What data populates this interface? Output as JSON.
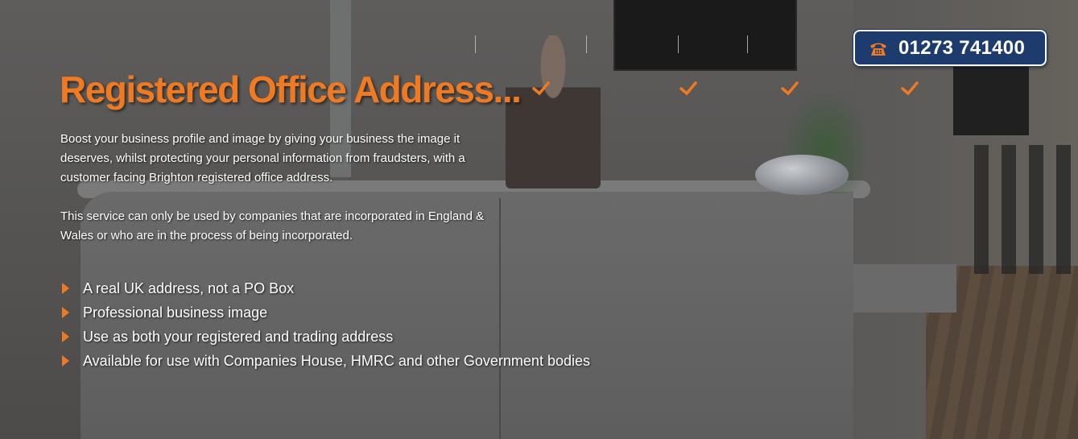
{
  "hero": {
    "title": "Registered Office Address...",
    "paragraphs": [
      "Boost your business profile and image by giving your business the image it deserves, whilst protecting your personal information from fraudsters, with a customer facing Brighton registered office address.",
      "This service can only be used by companies that are incorporated in England & Wales or who are in the process of being incorporated."
    ],
    "features": [
      "A real UK address, not a PO Box",
      "Professional business image",
      "Use as both your registered and trading address",
      "Available for use with Companies House, HMRC and other Government bodies"
    ]
  },
  "contact": {
    "phone": "01273 741400",
    "icon": "telephone-icon"
  },
  "colors": {
    "accent": "#f07a22",
    "button_bg": "#1d3c6d",
    "text": "#ffffff"
  }
}
